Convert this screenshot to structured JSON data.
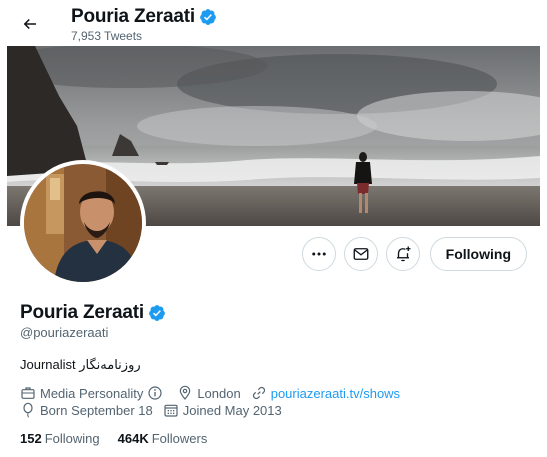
{
  "header": {
    "name": "Pouria Zeraati",
    "tweet_count": "7,953",
    "tweet_count_label": "Tweets",
    "back_icon": "arrow-left-icon",
    "verified_icon": "verified-badge-icon"
  },
  "actions": {
    "more_icon": "more-dots-icon",
    "message_icon": "envelope-icon",
    "notify_icon": "bell-plus-icon",
    "following_label": "Following"
  },
  "profile": {
    "name": "Pouria Zeraati",
    "handle": "@pouriazeraati",
    "bio": "Journalist روزنامه‌نگار",
    "category": "Media Personality",
    "location": "London",
    "website": "pouriazeraati.tv/shows",
    "birthday": "Born September 18",
    "joined": "Joined May 2013",
    "following_count": "152",
    "following_label": "Following",
    "followers_count": "464K",
    "followers_label": "Followers"
  },
  "colors": {
    "accent": "#1d9bf0",
    "text": "#0f1419",
    "muted": "#536471",
    "border": "#cfd9de"
  }
}
